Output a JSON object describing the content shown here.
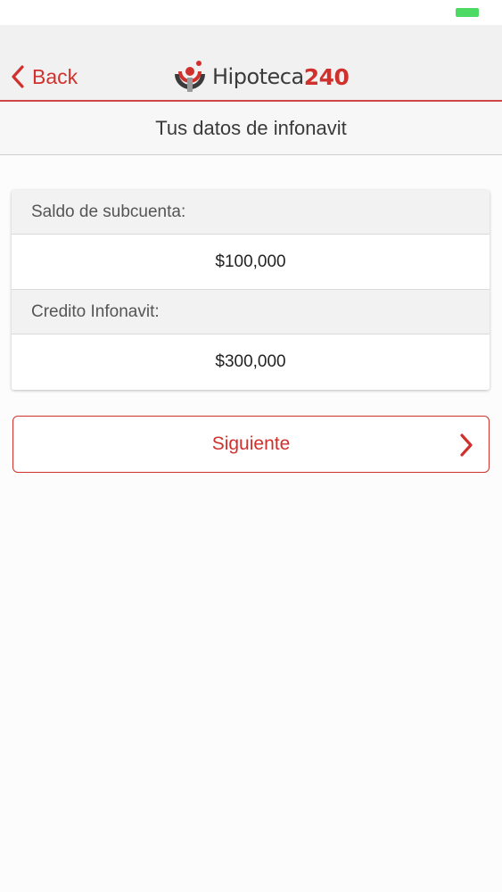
{
  "colors": {
    "accent": "#d0312d",
    "battery": "#4cd964",
    "logo_dark": "#3b3b3b"
  },
  "status_bar": {
    "battery_icon": "battery-icon"
  },
  "navbar": {
    "back_label": "Back",
    "back_icon": "chevron-left-icon",
    "logo_text": "Hipoteca",
    "logo_number": "240"
  },
  "header": {
    "title": "Tus datos de infonavit"
  },
  "fields": [
    {
      "label": "Saldo de subcuenta:",
      "value": "$100,000"
    },
    {
      "label": "Credito Infonavit:",
      "value": "$300,000"
    }
  ],
  "actions": {
    "next_label": "Siguiente",
    "next_icon": "chevron-right-icon"
  }
}
